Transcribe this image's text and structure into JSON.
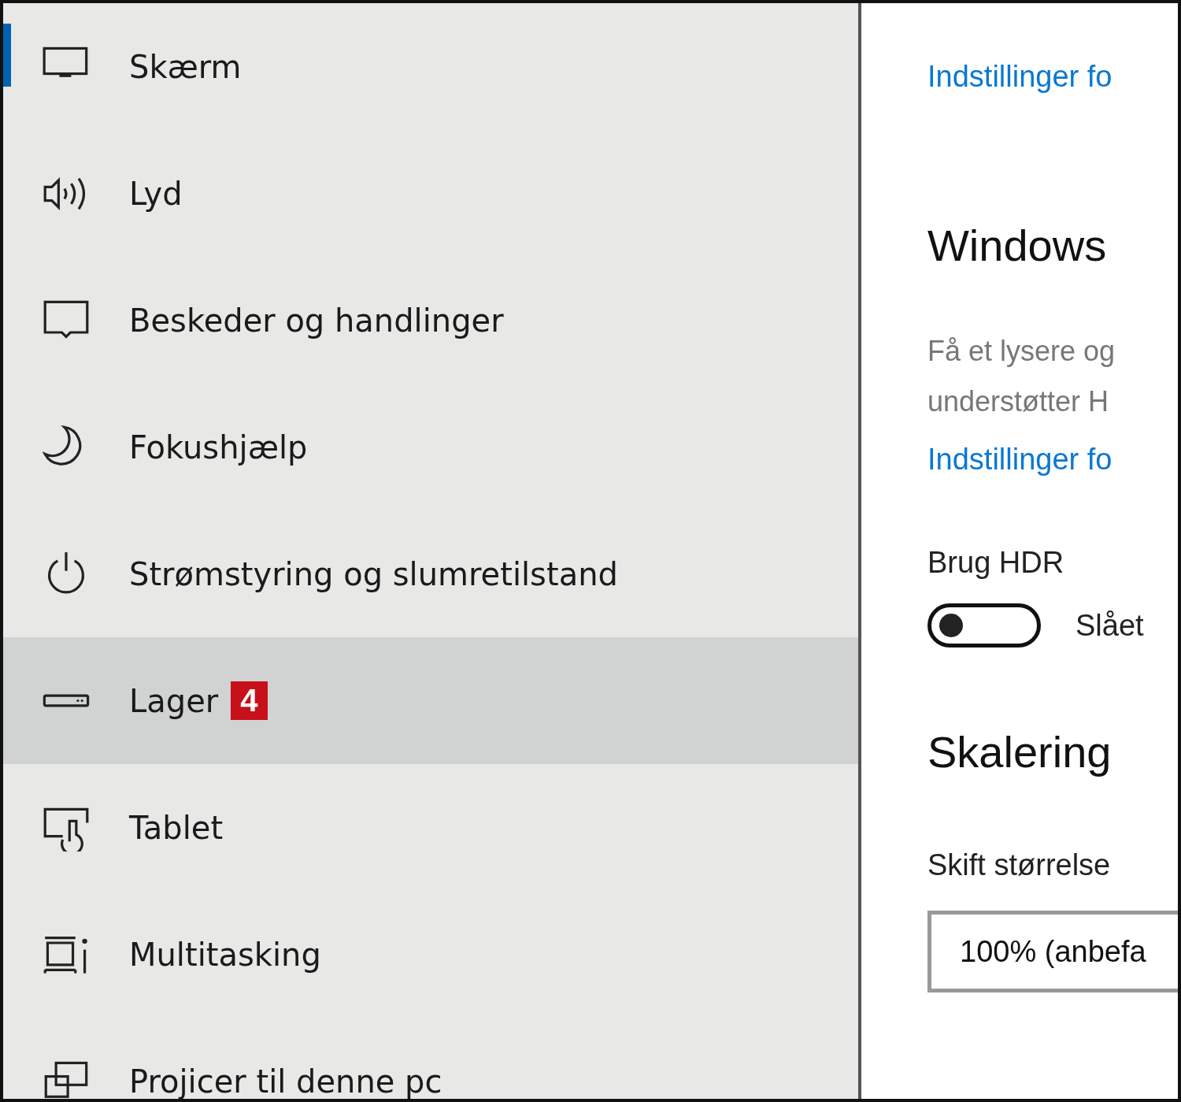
{
  "sidebar": {
    "items": [
      {
        "label": "Skærm",
        "selected": true,
        "hovered": false
      },
      {
        "label": "Lyd",
        "selected": false,
        "hovered": false
      },
      {
        "label": "Beskeder og handlinger",
        "selected": false,
        "hovered": false
      },
      {
        "label": "Fokushjælp",
        "selected": false,
        "hovered": false
      },
      {
        "label": "Strømstyring og slumretilstand",
        "selected": false,
        "hovered": false
      },
      {
        "label": "Lager",
        "selected": false,
        "hovered": true,
        "badge": "4"
      },
      {
        "label": "Tablet",
        "selected": false,
        "hovered": false
      },
      {
        "label": "Multitasking",
        "selected": false,
        "hovered": false
      },
      {
        "label": "Projicer til denne pc",
        "selected": false,
        "hovered": false
      }
    ]
  },
  "content": {
    "top_link": "Indstillinger fo",
    "hdr_heading": "Windows",
    "hdr_description": [
      "Få et lysere og",
      "understøtter H"
    ],
    "hdr_link": "Indstillinger fo",
    "hdr_toggle": {
      "label": "Brug HDR",
      "on": false,
      "state_text": "Slået"
    },
    "scaling_heading": "Skalering",
    "scaling_label": "Skift størrelse",
    "scaling_dropdown": {
      "value": "100% (anbefa"
    }
  }
}
